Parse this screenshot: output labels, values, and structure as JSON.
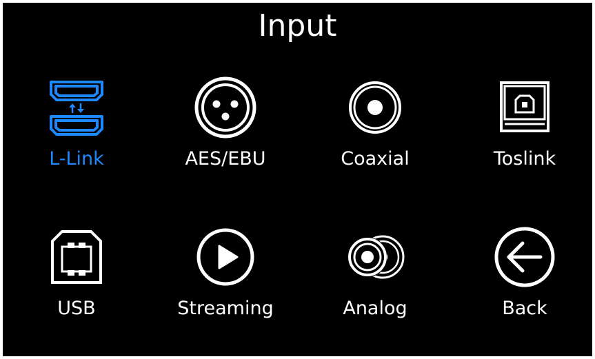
{
  "screen": {
    "title": "Input",
    "background_color": "#000000",
    "text_color": "#ffffff",
    "accent_color": "#1e88ff"
  },
  "inputs": [
    {
      "label": "L-Link",
      "icon": "l-link-icon",
      "selected": true
    },
    {
      "label": "AES/EBU",
      "icon": "xlr-icon",
      "selected": false
    },
    {
      "label": "Coaxial",
      "icon": "coaxial-icon",
      "selected": false
    },
    {
      "label": "Toslink",
      "icon": "toslink-icon",
      "selected": false
    },
    {
      "label": "USB",
      "icon": "usb-icon",
      "selected": false
    },
    {
      "label": "Streaming",
      "icon": "play-icon",
      "selected": false
    },
    {
      "label": "Analog",
      "icon": "analog-rca-icon",
      "selected": false
    },
    {
      "label": "Back",
      "icon": "back-arrow-icon",
      "selected": false
    }
  ]
}
